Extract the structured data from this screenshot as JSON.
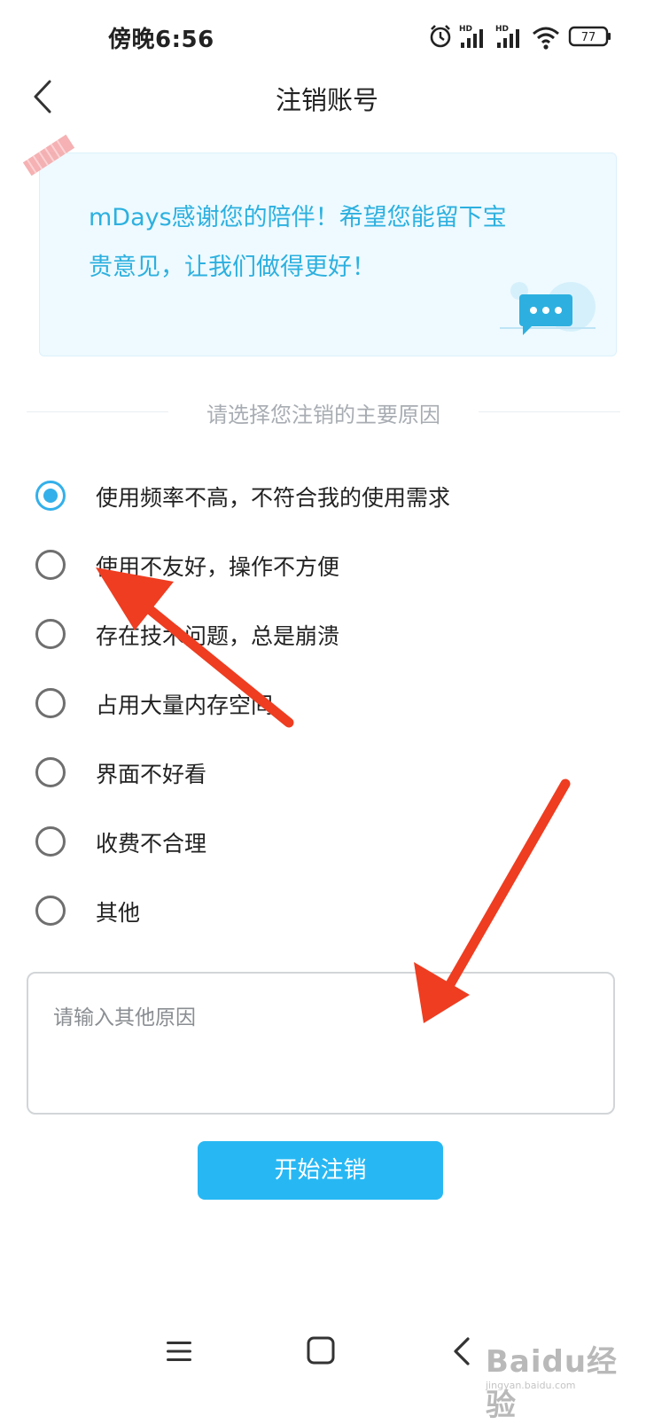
{
  "status_bar": {
    "time": "傍晚6:56",
    "signal_badge_1": "HD",
    "signal_badge_2": "HD",
    "battery": "77",
    "icons": [
      "alarm-icon",
      "signal-icon",
      "signal-icon",
      "wifi-icon",
      "battery-icon"
    ]
  },
  "header": {
    "title": "注销账号",
    "back_icon": "chevron-left-icon"
  },
  "note": {
    "line1": "mDays感谢您的陪伴！希望您能留下宝",
    "line2": "贵意见，让我们做得更好！",
    "accent_color": "#2db0df"
  },
  "reasons": {
    "section_label": "请选择您注销的主要原因",
    "selected_index": 0,
    "options": [
      "使用频率不高，不符合我的使用需求",
      "使用不友好，操作不方便",
      "存在技术问题，总是崩溃",
      "占用大量内存空间",
      "界面不好看",
      "收费不合理",
      "其他"
    ]
  },
  "other_reason": {
    "value": "",
    "placeholder": "请输入其他原因"
  },
  "submit": {
    "label": "开始注销",
    "color": "#27b8f4"
  },
  "nav_bar": {
    "icons": [
      "menu-icon",
      "home-icon",
      "back-icon"
    ]
  },
  "watermark": {
    "text": "Baidu经验",
    "sub": "jingyan.baidu.com"
  },
  "annotation": {
    "arrow_color": "#ee3d21"
  }
}
